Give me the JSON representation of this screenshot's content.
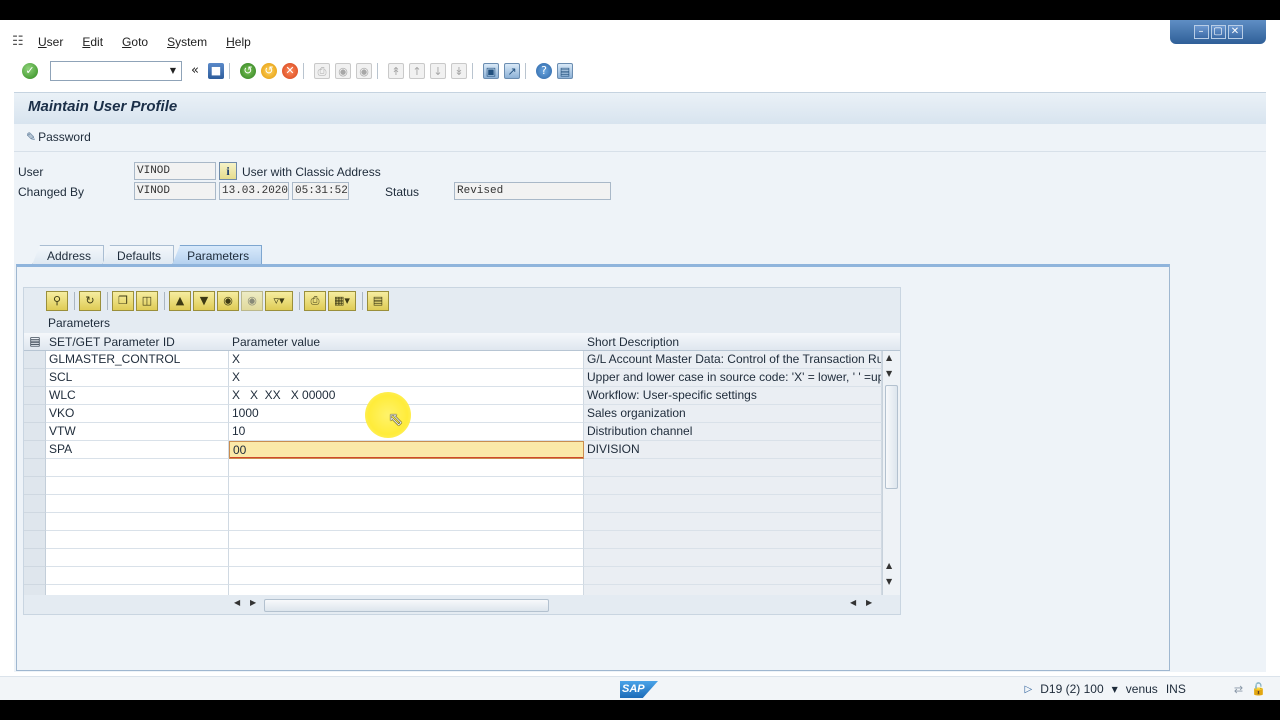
{
  "menu": {
    "items": [
      "User",
      "Edit",
      "Goto",
      "System",
      "Help"
    ]
  },
  "toolbar": {
    "command_value": ""
  },
  "window_controls": [
    "minimize-icon",
    "restore-icon",
    "close-icon"
  ],
  "screen": {
    "title": "Maintain User Profile",
    "password_button": "Password"
  },
  "header": {
    "user_label": "User",
    "user_value": "VINOD",
    "user_info_text": "User with Classic Address",
    "changed_by_label": "Changed By",
    "changed_by_value": "VINOD",
    "changed_date": "13.03.2020",
    "changed_time": "05:31:52",
    "status_label": "Status",
    "status_value": "Revised"
  },
  "tabs": [
    {
      "label": "Address",
      "active": false
    },
    {
      "label": "Defaults",
      "active": false
    },
    {
      "label": "Parameters",
      "active": true
    }
  ],
  "grid": {
    "title": "Parameters",
    "columns": [
      "SET/GET Parameter ID",
      "Parameter value",
      "Short Description"
    ],
    "rows": [
      {
        "id": "GLMASTER_CONTROL",
        "value": "X",
        "desc": "G/L Account Master Data: Control of the Transaction Run"
      },
      {
        "id": "SCL",
        "value": "X",
        "desc": "Upper and lower case in source code: 'X' = lower, ' ' =up"
      },
      {
        "id": "WLC",
        "value": "X   X  XX   X 00000",
        "desc": "Workflow: User-specific settings"
      },
      {
        "id": "VKO",
        "value": "1000",
        "desc": "Sales organization"
      },
      {
        "id": "VTW",
        "value": "10",
        "desc": "Distribution channel"
      },
      {
        "id": "SPA",
        "value": "00",
        "desc": "DIVISION"
      }
    ],
    "empty_rows": 8,
    "focused_row": 5
  },
  "statusbar": {
    "system": "D19 (2) 100",
    "server": "venus",
    "mode": "INS"
  },
  "colors": {
    "accent": "#8fb4dc",
    "focus_cell": "#fbe9a8"
  }
}
